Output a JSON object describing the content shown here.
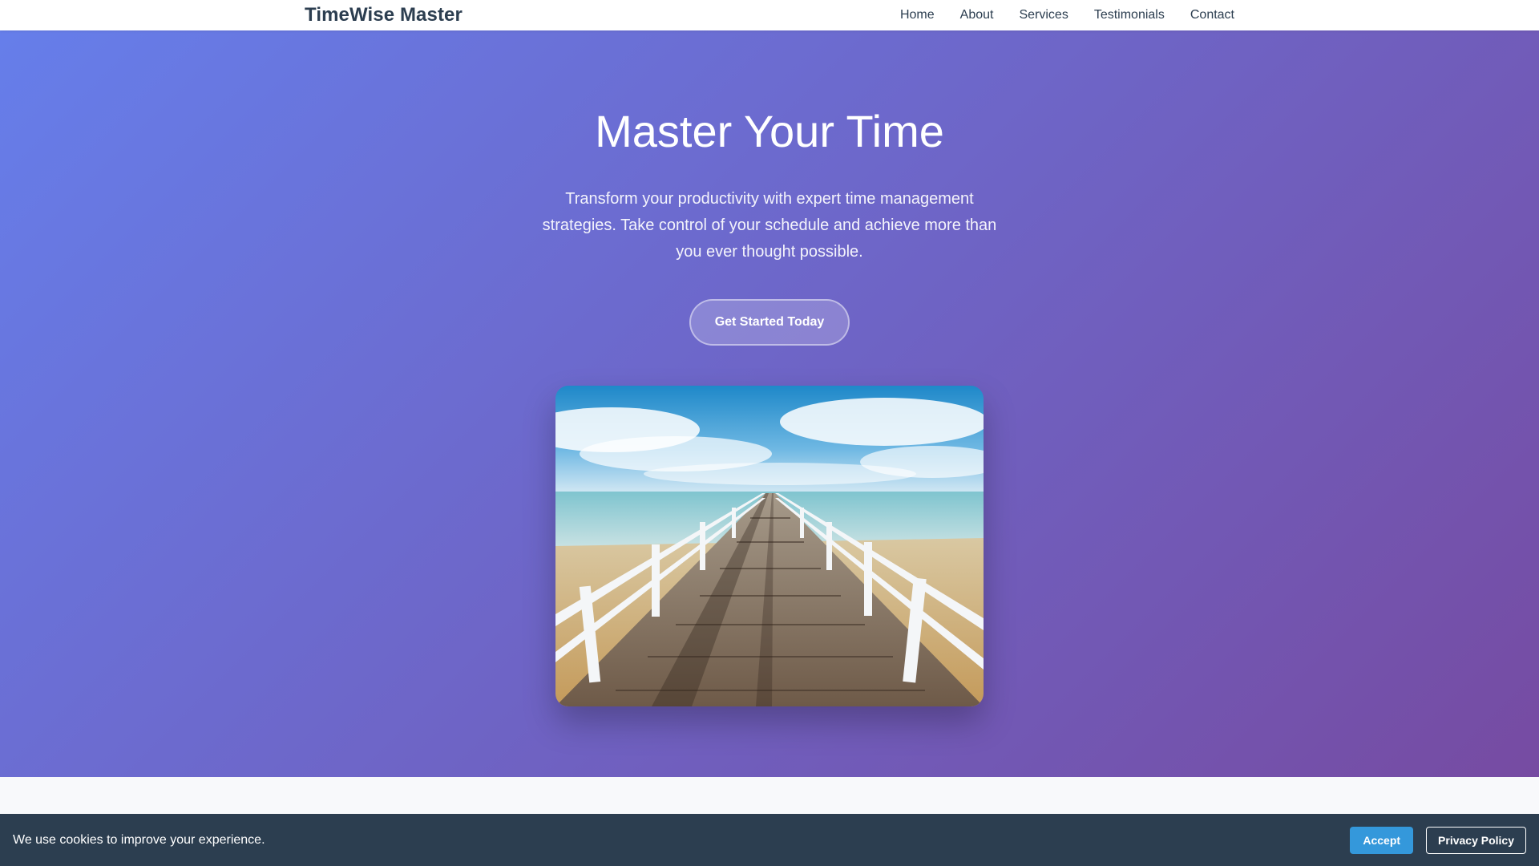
{
  "nav": {
    "brand": "TimeWise Master",
    "links": [
      {
        "label": "Home"
      },
      {
        "label": "About"
      },
      {
        "label": "Services"
      },
      {
        "label": "Testimonials"
      },
      {
        "label": "Contact"
      }
    ]
  },
  "hero": {
    "title": "Master Your Time",
    "subtitle": "Transform your productivity with expert time management strategies. Take control of your schedule and achieve more than you ever thought possible.",
    "cta_label": "Get Started Today",
    "gradient_start": "#667eea",
    "gradient_end": "#764ba2"
  },
  "cookie": {
    "message": "We use cookies to improve your experience.",
    "accept_label": "Accept",
    "privacy_label": "Privacy Policy",
    "accent": "#3498db",
    "background": "#2c3e50"
  }
}
